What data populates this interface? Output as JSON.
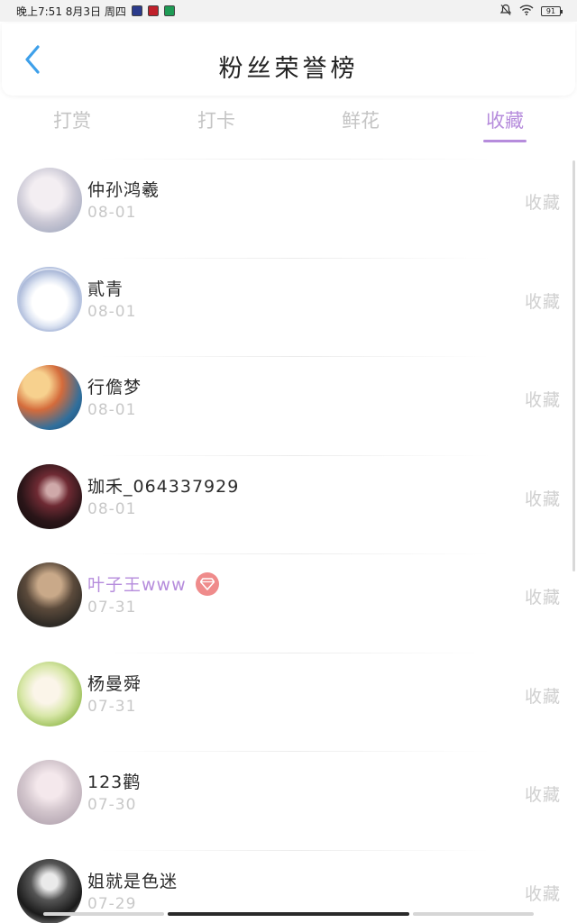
{
  "status_bar": {
    "time_text": "晚上7:51 8月3日 周四",
    "battery": "91"
  },
  "header": {
    "title": "粉丝荣誉榜"
  },
  "tabs": [
    {
      "label": "打赏"
    },
    {
      "label": "打卡"
    },
    {
      "label": "鲜花"
    },
    {
      "label": "收藏"
    }
  ],
  "active_tab": "收藏",
  "accent_color": "#b68cdc",
  "rows": [
    {
      "name": "仲孙鸿羲",
      "date": "08-01",
      "action": "收藏"
    },
    {
      "name": "貳青",
      "date": "08-01",
      "action": "收藏"
    },
    {
      "name": "行儋梦",
      "date": "08-01",
      "action": "收藏"
    },
    {
      "name": "珈禾_064337929",
      "date": "08-01",
      "action": "收藏"
    },
    {
      "name": "叶子王www",
      "date": "07-31",
      "action": "收藏",
      "vip": true
    },
    {
      "name": "杨曼舜",
      "date": "07-31",
      "action": "收藏"
    },
    {
      "name": "123鹳",
      "date": "07-30",
      "action": "收藏"
    },
    {
      "name": "姐就是色迷",
      "date": "07-29",
      "action": "收藏"
    }
  ]
}
